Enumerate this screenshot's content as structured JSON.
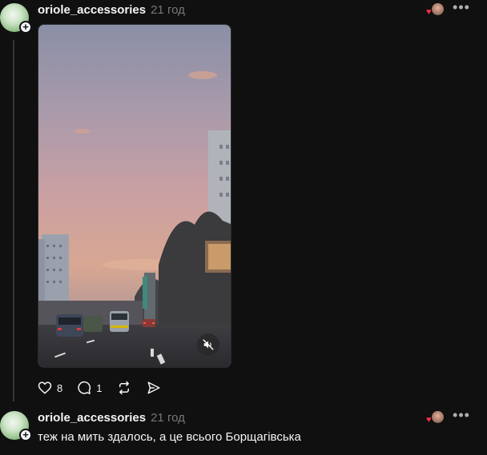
{
  "posts": [
    {
      "username": "oriole_accessories",
      "timestamp": "21 год",
      "reaction_icon": "heart-avatar",
      "more_label": "•••",
      "media": {
        "type": "video",
        "muted": true
      },
      "actions": {
        "like_count": "8",
        "reply_count": "1"
      }
    },
    {
      "username": "oriole_accessories",
      "timestamp": "21 год",
      "reaction_icon": "heart-avatar",
      "more_label": "•••",
      "text": "теж на мить здалось, а це всього Борщагівська"
    }
  ],
  "colors": {
    "background": "#101010",
    "text": "#f3f5f7",
    "muted_text": "#777777",
    "like_red": "#ff3040"
  }
}
